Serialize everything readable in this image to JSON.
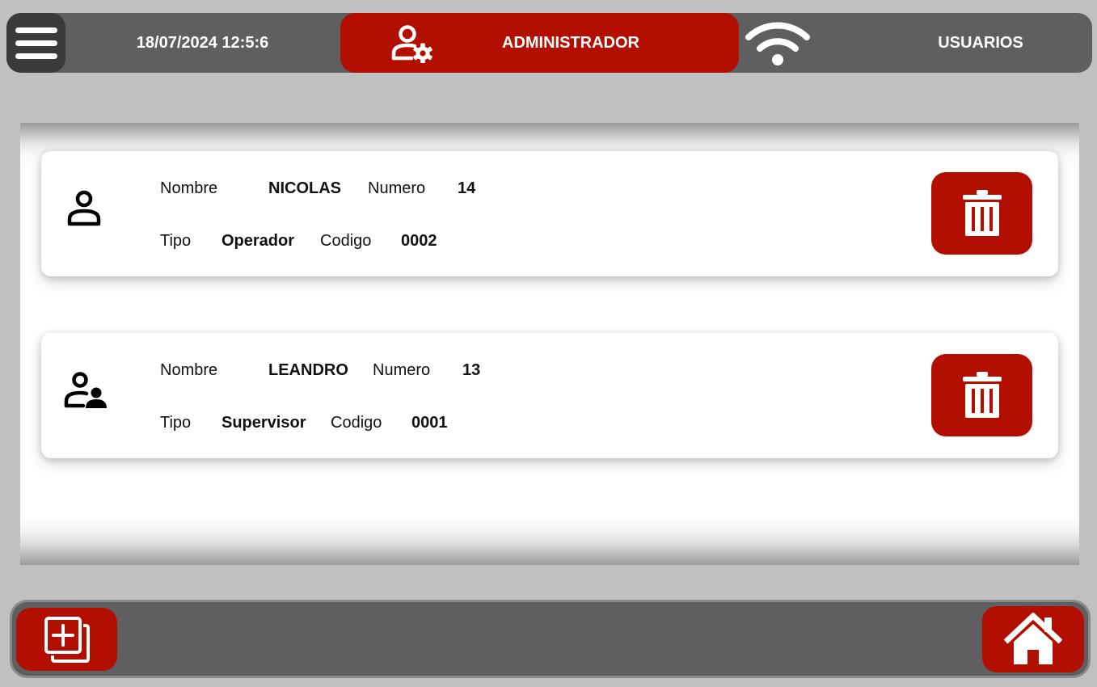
{
  "header": {
    "menu_icon": "hamburger-menu-icon",
    "datetime": "18/07/2024 12:5:6",
    "role": "ADMINISTRADOR",
    "role_icon": "user-gear-icon",
    "wifi_icon": "wifi-icon",
    "section": "USUARIOS"
  },
  "colors": {
    "accent": "#b30f00",
    "bar": "#5f5f61",
    "menu": "#3a3a3c",
    "background": "#c0c0c0"
  },
  "users": [
    {
      "icon": "user-icon",
      "name_label": "Nombre",
      "name": "NICOLAS",
      "number_label": "Numero",
      "number": "14",
      "type_label": "Tipo",
      "type": "Operador",
      "code_label": "Codigo",
      "code": "0002",
      "delete_icon": "trash-icon"
    },
    {
      "icon": "users-group-icon",
      "name_label": "Nombre",
      "name": "LEANDRO",
      "number_label": "Numero",
      "number": "13",
      "type_label": "Tipo",
      "type": "Supervisor",
      "code_label": "Codigo",
      "code": "0001",
      "delete_icon": "trash-icon"
    }
  ],
  "footer": {
    "add_icon": "add-copy-icon",
    "home_icon": "home-icon"
  }
}
